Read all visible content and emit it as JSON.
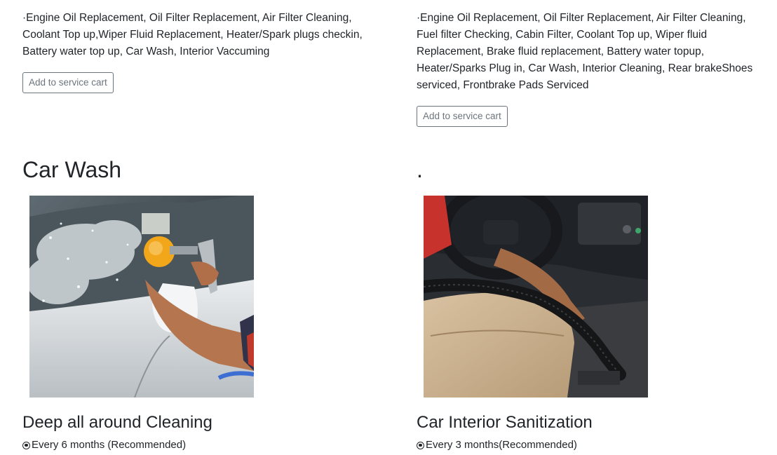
{
  "packages": [
    {
      "description": "·Engine Oil Replacement, Oil Filter Replacement, Air Filter Cleaning, Coolant Top up,Wiper Fluid Replacement, Heater/Spark plugs checkin, Battery water top up, Car Wash, Interior Vaccuming",
      "button_label": "Add to service cart"
    },
    {
      "description": "·Engine Oil Replacement, Oil Filter Replacement, Air Filter Cleaning, Fuel filter Checking, Cabin Filter, Coolant Top up, Wiper fluid Replacement, Brake fluid replacement, Battery water topup, Heater/Sparks Plug in, Car Wash, Interior Cleaning, Rear brakeShoes serviced, Frontbrake Pads Serviced",
      "button_label": "Add to service cart"
    }
  ],
  "section": {
    "title": "Car Wash",
    "right_heading": "."
  },
  "services": [
    {
      "title": "Deep all around Cleaning",
      "frequency": "Every 6 months (Recommended)",
      "image_icon": "car-exterior-spray-wash-photo"
    },
    {
      "title": "Car Interior Sanitization",
      "frequency": "Every 3 months(Recommended)",
      "image_icon": "car-interior-vacuum-photo"
    }
  ],
  "colors": {
    "text": "#212529",
    "button_border": "#6c757d",
    "background": "#ffffff"
  }
}
